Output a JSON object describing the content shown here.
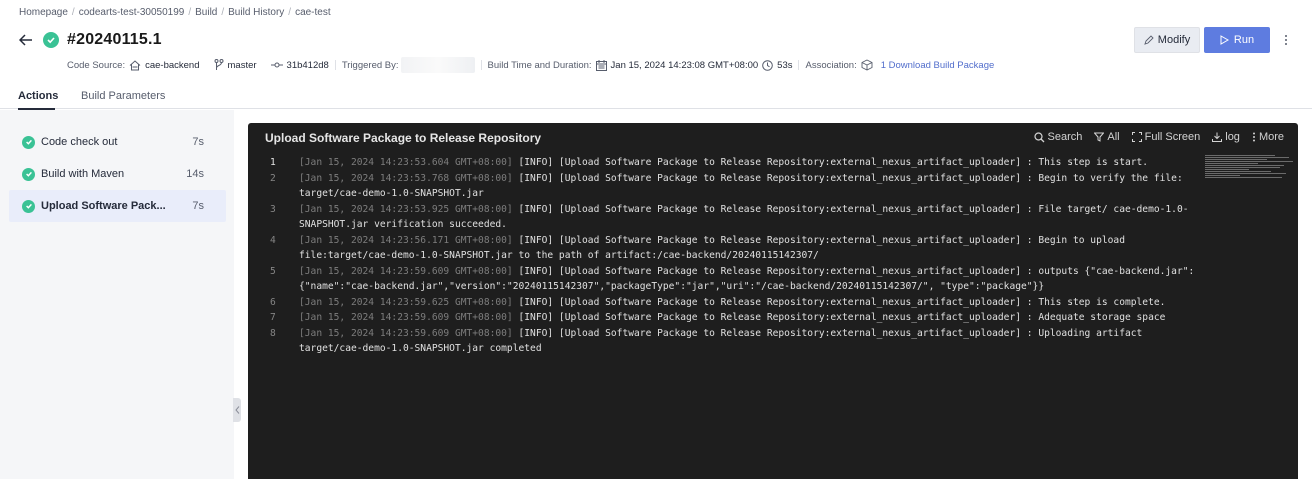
{
  "breadcrumb": [
    "Homepage",
    "codearts-test-30050199",
    "Build",
    "Build History",
    "cae-test"
  ],
  "build": {
    "number": "#20240115.1"
  },
  "buttons": {
    "modify": "Modify",
    "run": "Run"
  },
  "meta": {
    "code_source_label": "Code Source:",
    "code_source": "cae-backend",
    "branch": "master",
    "commit": "31b412d8",
    "triggered_by_label": "Triggered By:",
    "build_time_label": "Build Time and Duration:",
    "build_time": "Jan 15, 2024 14:23:08 GMT+08:00",
    "duration": "53s",
    "association_label": "Association:",
    "association_link": "1 Download Build Package"
  },
  "tabs": [
    {
      "label": "Actions",
      "active": true
    },
    {
      "label": "Build Parameters",
      "active": false
    }
  ],
  "steps": [
    {
      "name": "Code check out",
      "time": "7s",
      "active": false
    },
    {
      "name": "Build with Maven",
      "time": "14s",
      "active": false
    },
    {
      "name": "Upload Software Pack...",
      "time": "7s",
      "active": true
    }
  ],
  "log": {
    "title": "Upload Software Package to Release Repository",
    "tools": {
      "search": "Search",
      "all": "All",
      "fullscreen": "Full Screen",
      "log": "log",
      "more": "More"
    },
    "lines": [
      {
        "num": "1",
        "ts": "[Jan 15, 2024 14:23:53.604 GMT+08:00]",
        "msg": " [INFO] [Upload Software Package to Release Repository:external_nexus_artifact_uploader] : This step is start."
      },
      {
        "num": "2",
        "ts": "[Jan 15, 2024 14:23:53.768 GMT+08:00]",
        "msg": " [INFO] [Upload Software Package to Release Repository:external_nexus_artifact_uploader] : Begin to verify the file: target/cae-demo-1.0-SNAPSHOT.jar"
      },
      {
        "num": "3",
        "ts": "[Jan 15, 2024 14:23:53.925 GMT+08:00]",
        "msg": " [INFO] [Upload Software Package to Release Repository:external_nexus_artifact_uploader] : File target/ cae-demo-1.0-SNAPSHOT.jar verification succeeded."
      },
      {
        "num": "4",
        "ts": "[Jan 15, 2024 14:23:56.171 GMT+08:00]",
        "msg": " [INFO] [Upload Software Package to Release Repository:external_nexus_artifact_uploader] : Begin to upload file:target/cae-demo-1.0-SNAPSHOT.jar to the path of artifact:/cae-backend/20240115142307/"
      },
      {
        "num": "5",
        "ts": "[Jan 15, 2024 14:23:59.609 GMT+08:00]",
        "msg": " [INFO] [Upload Software Package to Release Repository:external_nexus_artifact_uploader] : outputs {\"cae-backend.jar\":{\"name\":\"cae-backend.jar\",\"version\":\"20240115142307\",\"packageType\":\"jar\",\"uri\":\"/cae-backend/20240115142307/\", \"type\":\"package\"}}"
      },
      {
        "num": "6",
        "ts": "[Jan 15, 2024 14:23:59.625 GMT+08:00]",
        "msg": " [INFO] [Upload Software Package to Release Repository:external_nexus_artifact_uploader] : This step is complete."
      },
      {
        "num": "7",
        "ts": "[Jan 15, 2024 14:23:59.609 GMT+08:00]",
        "msg": " [INFO] [Upload Software Package to Release Repository:external_nexus_artifact_uploader] : Adequate storage space"
      },
      {
        "num": "8",
        "ts": "[Jan 15, 2024 14:23:59.609 GMT+08:00]",
        "msg": " [INFO] [Upload Software Package to Release Repository:external_nexus_artifact_uploader] : Uploading artifact target/cae-demo-1.0-SNAPSHOT.jar completed"
      }
    ]
  },
  "colors": {
    "success": "#3ac295",
    "primary": "#5e7ce0",
    "link": "#526ecc",
    "log_bg": "#1e1e1e"
  }
}
